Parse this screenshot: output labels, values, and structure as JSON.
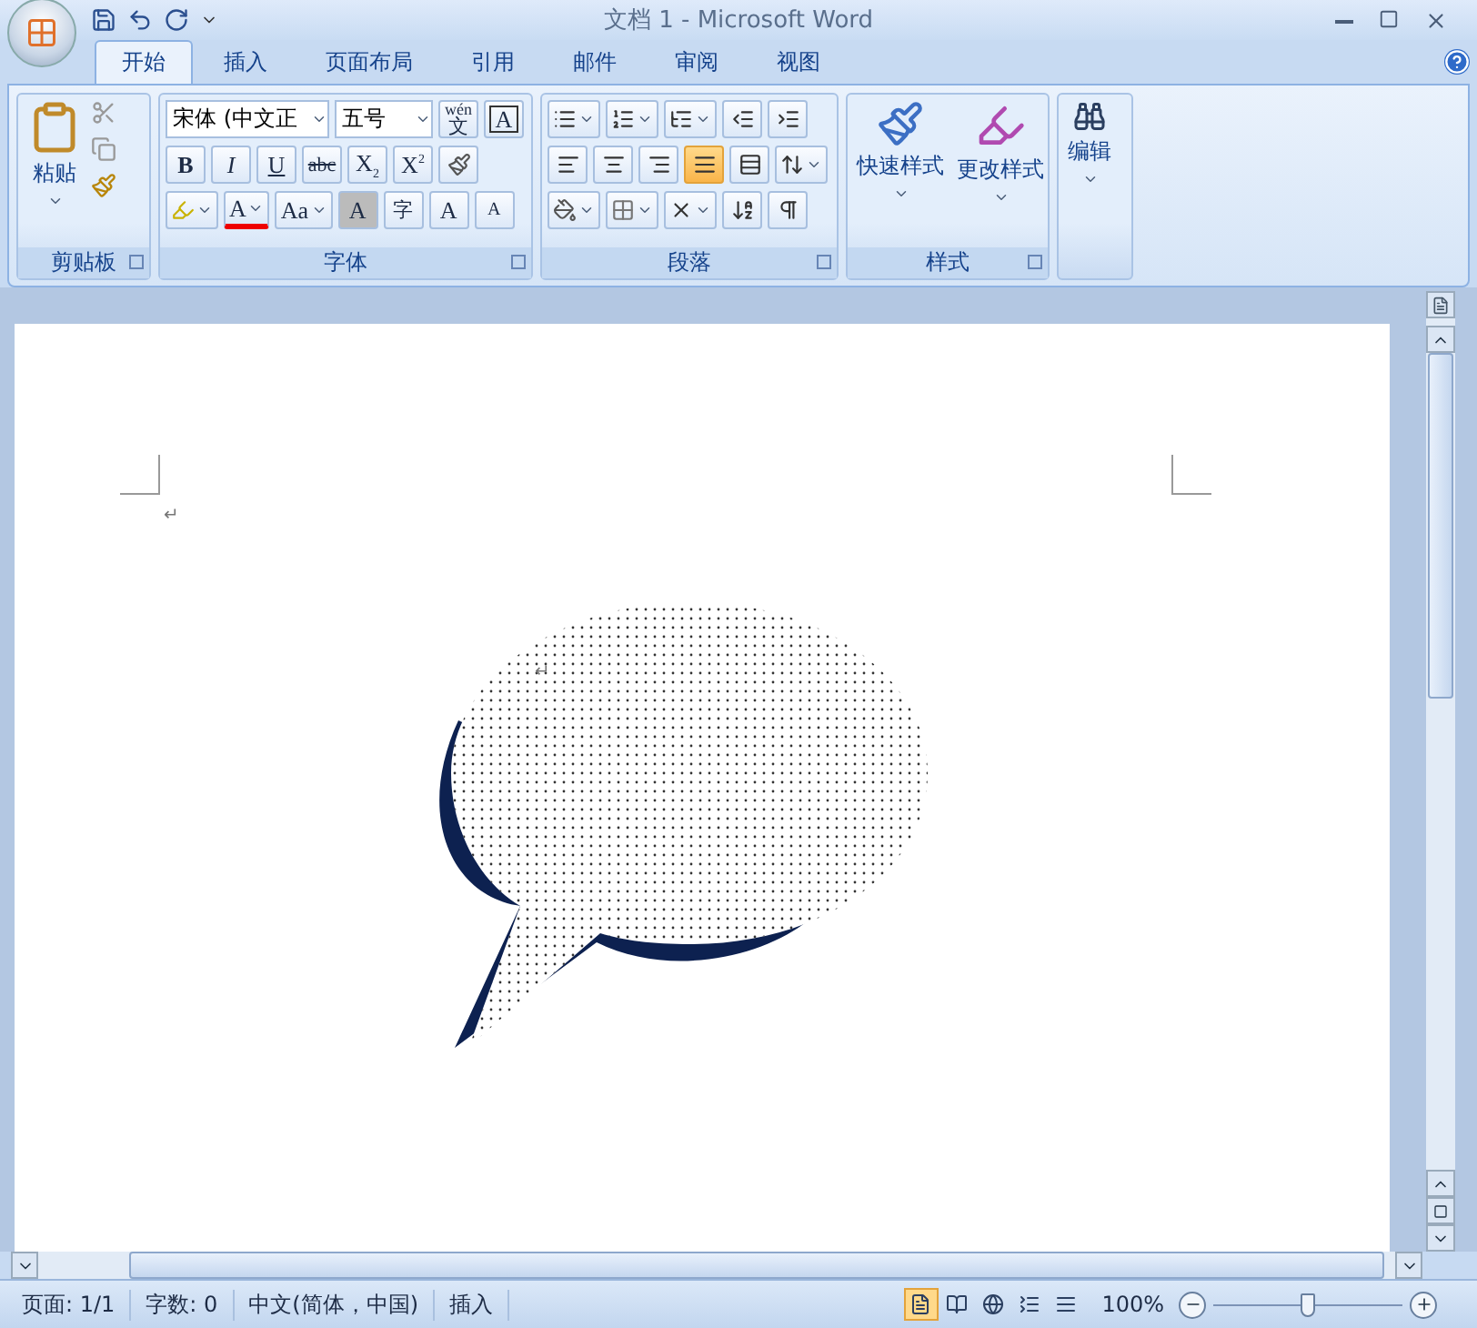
{
  "window": {
    "title": "文档 1 - Microsoft Word"
  },
  "tabs": [
    {
      "label": "开始",
      "selected": true
    },
    {
      "label": "插入",
      "selected": false
    },
    {
      "label": "页面布局",
      "selected": false
    },
    {
      "label": "引用",
      "selected": false
    },
    {
      "label": "邮件",
      "selected": false
    },
    {
      "label": "审阅",
      "selected": false
    },
    {
      "label": "视图",
      "selected": false
    }
  ],
  "ribbon": {
    "clipboard": {
      "paste": "粘贴",
      "group": "剪贴板"
    },
    "font": {
      "font_name": "宋体 (中文正",
      "font_size": "五号",
      "phonetic_top": "wén",
      "phonetic_main": "文",
      "border_char": "A",
      "bold": "B",
      "italic": "I",
      "underline": "U",
      "strike": "abc",
      "subscript": "X",
      "subscript_mark": "2",
      "superscript": "X",
      "superscript_mark": "2",
      "font_color": "A",
      "change_case": "Aa",
      "shading": "A",
      "enclose": "字",
      "grow": "A",
      "shrink": "A",
      "group": "字体"
    },
    "paragraph": {
      "alignment": [
        {
          "kind": "left",
          "selected": false
        },
        {
          "kind": "center",
          "selected": false
        },
        {
          "kind": "right",
          "selected": false
        },
        {
          "kind": "justify",
          "selected": true
        },
        {
          "kind": "distribute",
          "selected": false
        }
      ],
      "group": "段落"
    },
    "styles": {
      "quick": "快速样式",
      "change": "更改样式",
      "group": "样式"
    },
    "editing": {
      "label": "编辑"
    }
  },
  "document": {
    "marks": [
      "↵",
      "↵"
    ]
  },
  "status_bar": {
    "items": [
      "页面: 1/1",
      "字数: 0",
      "中文(简体，中国)",
      "插入"
    ],
    "views": [
      {
        "kind": "print",
        "selected": true
      },
      {
        "kind": "reading",
        "selected": false
      },
      {
        "kind": "web",
        "selected": false
      },
      {
        "kind": "outline",
        "selected": false
      },
      {
        "kind": "draft",
        "selected": false
      }
    ],
    "zoom": "100%",
    "zoom_slider": {
      "level": 0.5
    }
  }
}
